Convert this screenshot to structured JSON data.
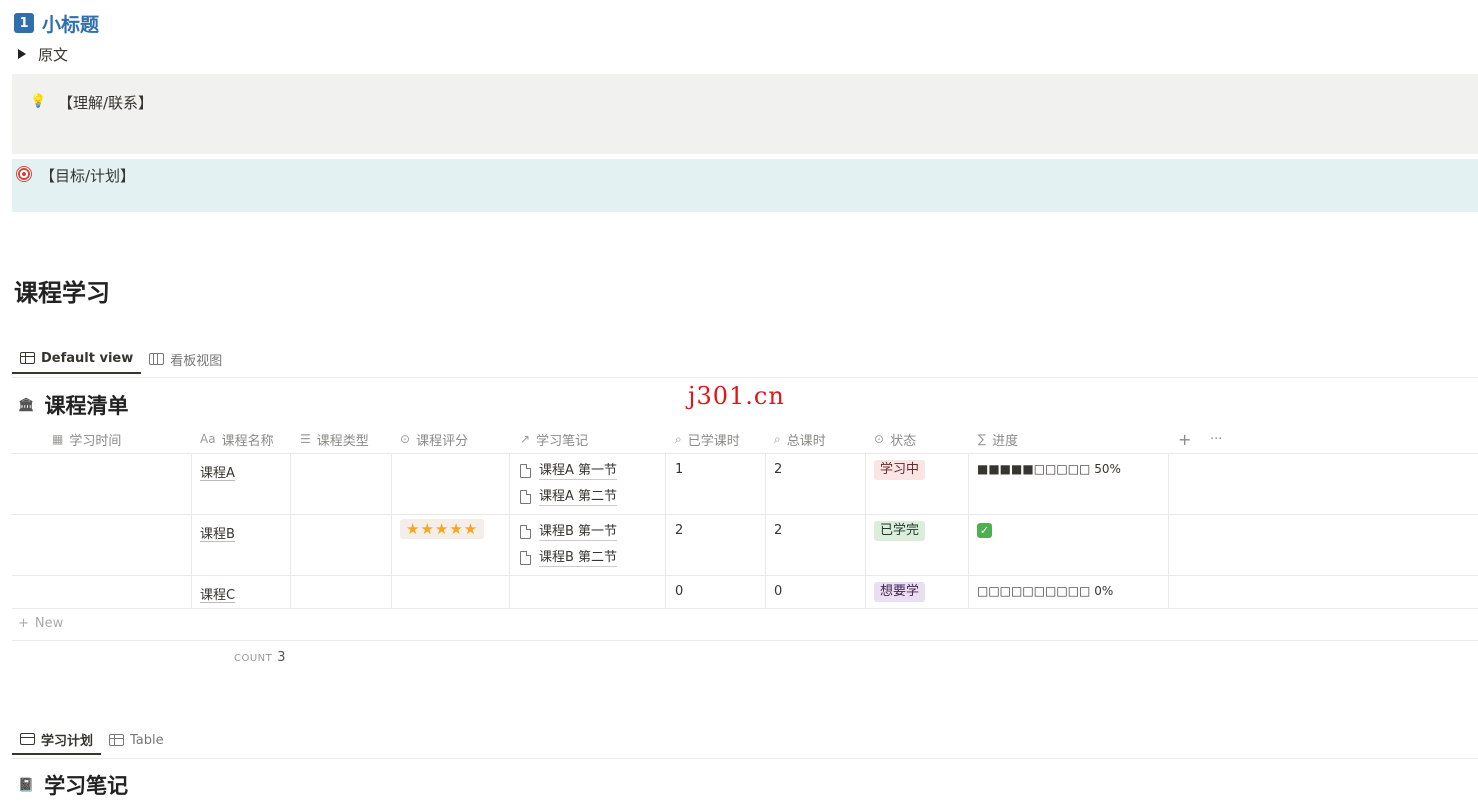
{
  "heading": {
    "number": "1",
    "text": "小标题"
  },
  "toggle": {
    "label": "原文"
  },
  "callouts": {
    "understanding": {
      "icon": "lightbulb-icon",
      "text": "【理解/联系】"
    },
    "goal": {
      "icon": "target-icon",
      "text": "【目标/计划】"
    }
  },
  "section_title": "课程学习",
  "course_db": {
    "tabs": [
      {
        "label": "Default view",
        "icon": "table-icon",
        "active": true
      },
      {
        "label": "看板视图",
        "icon": "board-icon",
        "active": false
      }
    ],
    "title": "课程清单",
    "columns": [
      {
        "label": "学习时间",
        "icon": "calendar-icon"
      },
      {
        "label": "课程名称",
        "icon_text": "Aa"
      },
      {
        "label": "课程类型",
        "icon": "list-icon"
      },
      {
        "label": "课程评分",
        "icon": "select-icon"
      },
      {
        "label": "学习笔记",
        "icon": "relation-arrow-icon"
      },
      {
        "label": "已学课时",
        "icon": "search-icon"
      },
      {
        "label": "总课时",
        "icon": "search-icon"
      },
      {
        "label": "状态",
        "icon": "select-icon"
      },
      {
        "label": "进度",
        "icon_text": "∑"
      }
    ],
    "rows": [
      {
        "name": "课程A",
        "rating": "",
        "notes": [
          "课程A 第一节",
          "课程A 第二节"
        ],
        "learned": "1",
        "total": "2",
        "status": {
          "label": "学习中",
          "bg": "#fbe4e4",
          "fg": "#5d2b2b"
        },
        "progress": "■■■■■□□□□□ 50%"
      },
      {
        "name": "课程B",
        "rating": "★★★★★",
        "notes": [
          "课程B 第一节",
          "课程B 第二节"
        ],
        "learned": "2",
        "total": "2",
        "status": {
          "label": "已学完",
          "bg": "#dbeddb",
          "fg": "#1c3829"
        },
        "progress": "✓"
      },
      {
        "name": "课程C",
        "rating": "",
        "notes": [],
        "learned": "0",
        "total": "0",
        "status": {
          "label": "想要学",
          "bg": "#eadff1",
          "fg": "#412454"
        },
        "progress": "□□□□□□□□□□ 0%"
      }
    ],
    "new_label": "New",
    "count_label": "COUNT",
    "count_value": "3",
    "add_icon": "+",
    "more_icon": "···"
  },
  "notes_db": {
    "tabs": [
      {
        "label": "学习计划",
        "icon": "calendar-icon",
        "active": true
      },
      {
        "label": "Table",
        "icon": "table-icon",
        "active": false
      }
    ],
    "title": "学习笔记"
  },
  "watermark": "j301.cn"
}
